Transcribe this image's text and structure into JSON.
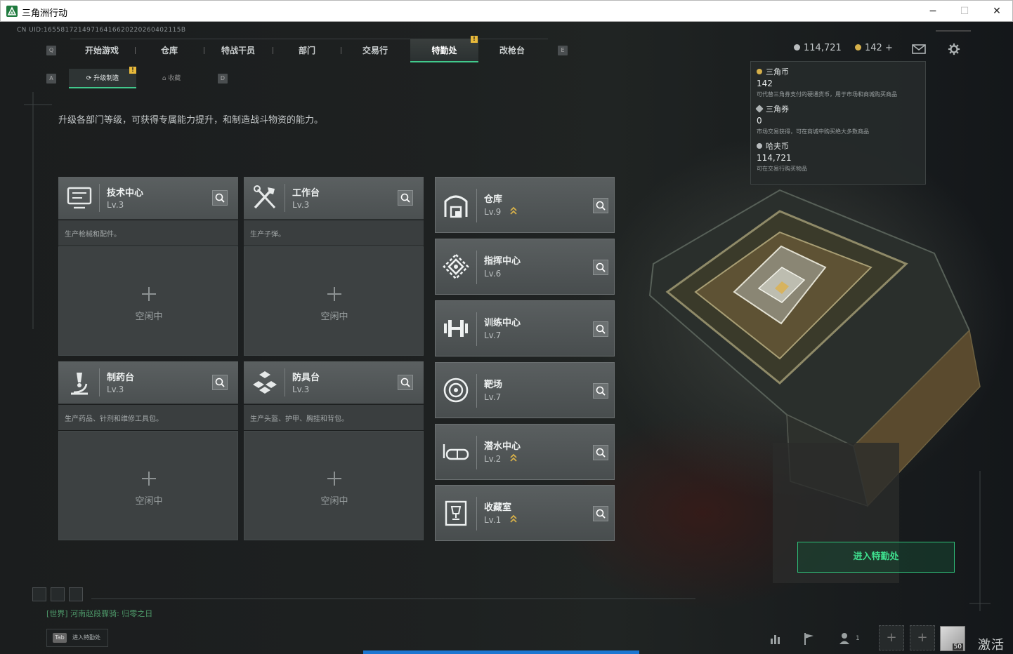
{
  "window": {
    "title": "三角洲行动",
    "minimize": "−",
    "maximize": "☐",
    "close": "✕"
  },
  "uid": "CN UID:16558172149716416620220260402115B",
  "nav": {
    "key_left": "Q",
    "key_right": "E",
    "tabs": [
      {
        "label": "开始游戏"
      },
      {
        "label": "仓库"
      },
      {
        "label": "特战干员"
      },
      {
        "label": "部门"
      },
      {
        "label": "交易行"
      },
      {
        "label": "特勤处",
        "active": true
      },
      {
        "label": "改枪台"
      }
    ],
    "badge": "!"
  },
  "subnav": {
    "key_left": "A",
    "key_right": "D",
    "tabs": [
      {
        "label": "升级制造",
        "active": true
      },
      {
        "label": "收藏"
      }
    ],
    "badge": "!"
  },
  "currency": {
    "hafu": "114,721",
    "sanjiao": "142 +",
    "colors": {
      "hafu": "#b9bdbf",
      "sanjiao": "#d6b04a"
    }
  },
  "tooltip": {
    "items": [
      {
        "name": "三角币",
        "value": "142",
        "desc": "可代替三角券支付的硬通货币，用于市场和商城购买商品"
      },
      {
        "name": "三角券",
        "value": "0",
        "desc": "市场交易获得，可在商城中购买绝大多数商品"
      },
      {
        "name": "哈夫币",
        "value": "114,721",
        "desc": "可在交易行购买物品"
      }
    ]
  },
  "description": "升级各部门等级，可获得专属能力提升，和制造战斗物资的能力。",
  "workshops": [
    {
      "name": "技术中心",
      "level": "Lv.3",
      "desc": "生产枪械和配件。",
      "status": "空闲中",
      "icon": "monitor-icon"
    },
    {
      "name": "工作台",
      "level": "Lv.3",
      "desc": "生产子弹。",
      "status": "空闲中",
      "icon": "tools-icon"
    },
    {
      "name": "制药台",
      "level": "Lv.3",
      "desc": "生产药品、针剂和维修工具包。",
      "status": "空闲中",
      "icon": "microscope-icon"
    },
    {
      "name": "防具台",
      "level": "Lv.3",
      "desc": "生产头盔、护甲、胸挂和背包。",
      "status": "空闲中",
      "icon": "armor-icon"
    }
  ],
  "departments": [
    {
      "name": "仓库",
      "level": "Lv.9",
      "upgrade": true,
      "icon": "warehouse-icon"
    },
    {
      "name": "指挥中心",
      "level": "Lv.6",
      "upgrade": false,
      "icon": "command-icon"
    },
    {
      "name": "训练中心",
      "level": "Lv.7",
      "upgrade": false,
      "icon": "dumbbell-icon"
    },
    {
      "name": "靶场",
      "level": "Lv.7",
      "upgrade": false,
      "icon": "target-icon"
    },
    {
      "name": "潜水中心",
      "level": "Lv.2",
      "upgrade": true,
      "icon": "goggles-icon"
    },
    {
      "name": "收藏室",
      "level": "Lv.1",
      "upgrade": true,
      "icon": "trophy-icon"
    }
  ],
  "enter_button": "进入特勤处",
  "chat": "[世界] 河南赵段骤骑: 归零之日",
  "tab_hint": {
    "key": "Tab",
    "label": "进入特勤处"
  },
  "social_count": "1",
  "avatar_level": "50",
  "watermark": "激活",
  "accent_color": "#41c98c"
}
